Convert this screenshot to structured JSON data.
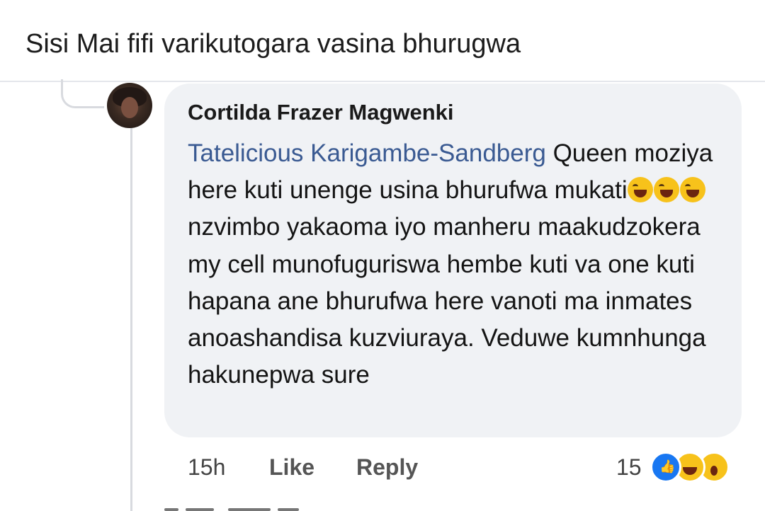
{
  "post": {
    "caption": "Sisi Mai fifi varikutogara vasina bhurugwa"
  },
  "comment": {
    "author": "Cortilda Frazer Magwenki",
    "mention": "Tatelicious Karigambe-Sandberg",
    "text_part1": " Queen moziya here kuti unenge usina bhurufwa mukati",
    "emoji_icon": "rolling-on-floor-laughing-emoji",
    "text_part2": "nzvimbo yakaoma iyo manheru maakudzokera my cell munofuguriswa hembe kuti va one kuti hapana ane bhurufwa here vanoti ma inmates anoashandisa kuzviuraya. Veduwe kumnhunga hakunepwa sure",
    "time": "15h",
    "like_label": "Like",
    "reply_label": "Reply",
    "reaction_count": "15",
    "reactions": [
      "like-reaction-icon",
      "haha-reaction-icon",
      "wow-reaction-icon"
    ]
  },
  "colors": {
    "bubble": "#f0f2f5",
    "mention": "#3a5a92",
    "like_blue": "#1877f2",
    "emoji_yellow": "#f7c21b"
  }
}
